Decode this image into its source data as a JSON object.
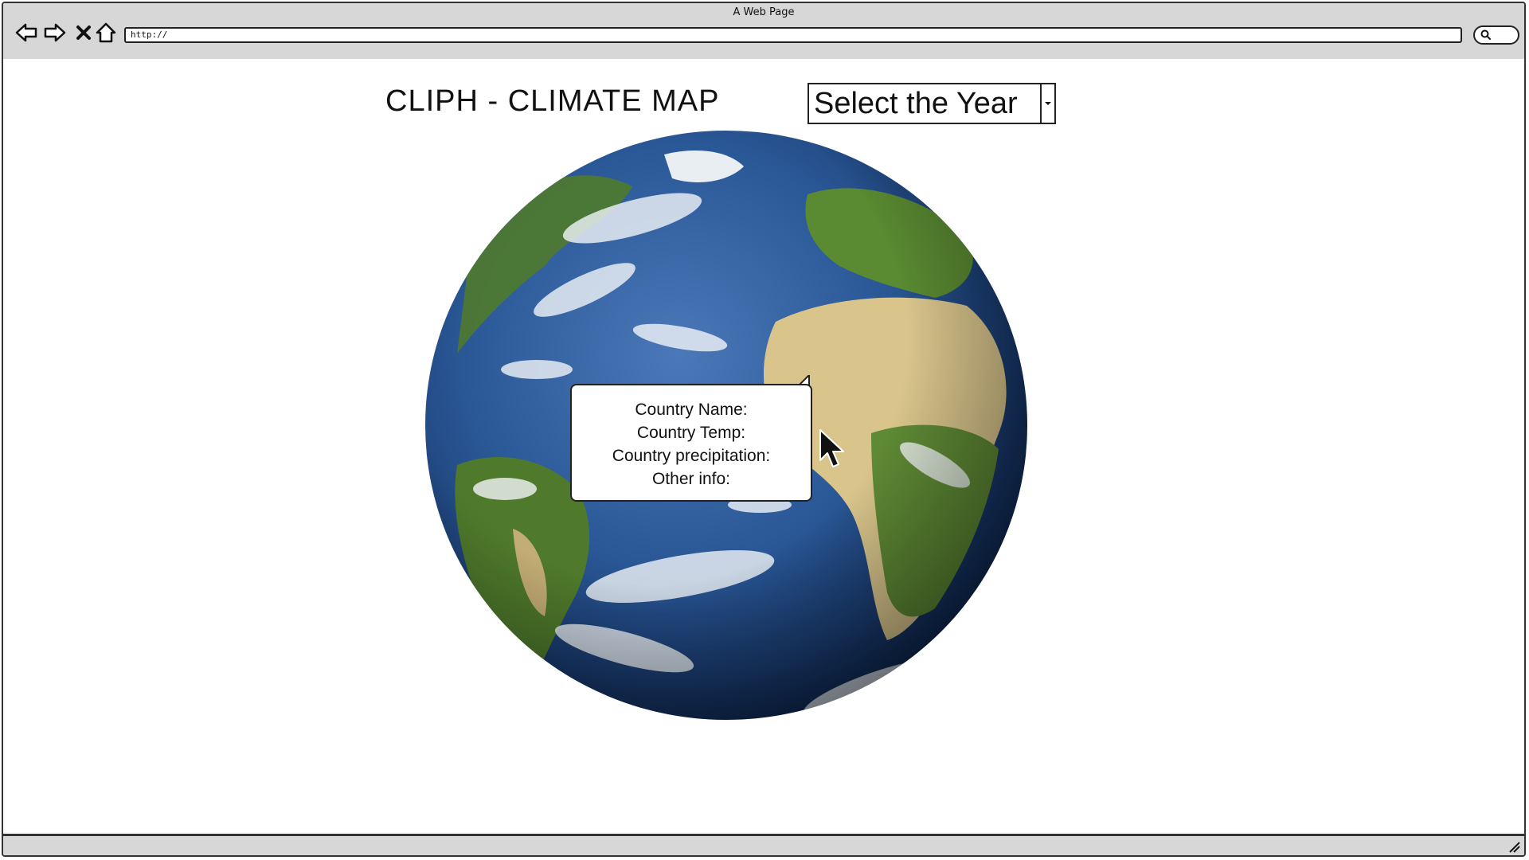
{
  "window": {
    "title": "A Web Page"
  },
  "toolbar": {
    "back_icon": "arrow-left-icon",
    "forward_icon": "arrow-right-icon",
    "stop_icon": "close-icon",
    "home_icon": "home-icon",
    "url": "http://",
    "search_icon": "search-icon"
  },
  "page": {
    "title": "CLIPH - CLIMATE MAP",
    "year_select": {
      "selected_label": "Select the Year",
      "arrow_icon": "chevron-down-icon"
    },
    "globe": {
      "image": "earth-globe"
    },
    "tooltip": {
      "lines": [
        "Country Name:",
        "Country Temp:",
        "Country precipitation:",
        "Other info:"
      ]
    }
  },
  "colors": {
    "chrome_gray": "#d7d7d7",
    "ocean_blue": "#1f4f8f",
    "land_green": "#4f7a2c",
    "desert_tan": "#d9c58c",
    "cloud_white": "#f2f5f8"
  }
}
